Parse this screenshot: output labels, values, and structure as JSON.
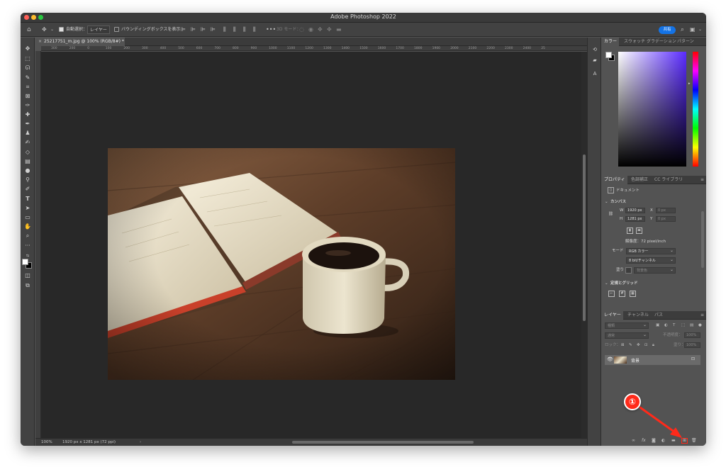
{
  "app": {
    "title": "Adobe Photoshop 2022"
  },
  "colors": {
    "accent": "#1473e6",
    "annotation": "#ff2a1a",
    "canvas": "#282828",
    "panel": "#535353"
  },
  "options_bar": {
    "auto_select_label": "自動選択：",
    "auto_select_value": "レイヤー",
    "show_bbox_label": "バウンディングボックスを表示",
    "mode_3d_label": "3D モード：",
    "share_label": "共有"
  },
  "document": {
    "tab_title": "25217751_m.jpg @ 100% (RGB/8#) *",
    "zoom": "100%",
    "status": "1920 px x 1281 px (72 ppi)"
  },
  "ruler": {
    "ticks": [
      "300",
      "200",
      "0",
      "100",
      "200",
      "300",
      "400",
      "500",
      "600",
      "700",
      "800",
      "900",
      "1000",
      "1100",
      "1200",
      "1300",
      "1400",
      "1500",
      "1600",
      "1700",
      "1800",
      "1900",
      "2000",
      "2100",
      "2200",
      "2300",
      "2400",
      "25"
    ]
  },
  "color_panel": {
    "tabs": [
      "カラー",
      "スウォッチ",
      "グラデーション",
      "パターン"
    ]
  },
  "properties_panel": {
    "tabs": [
      "プロパティ",
      "色調補正",
      "CC ライブラリ"
    ],
    "doc_label": "ドキュメント",
    "canvas_section": "カンバス",
    "w_label": "W",
    "w_value": "1920 px",
    "h_label": "H",
    "h_value": "1281 px",
    "x_label": "X",
    "x_value": "0 px",
    "y_label": "Y",
    "y_value": "0 px",
    "resolution": "解像度：72 pixel/inch",
    "mode_label": "モード",
    "mode_value": "RGB カラー",
    "depth_value": "8 bit/チャンネル",
    "fill_label": "塗り",
    "fill_value": "背景色",
    "guides_section": "定規とグリッド"
  },
  "layers_panel": {
    "tabs": [
      "レイヤー",
      "チャンネル",
      "パス"
    ],
    "filter_placeholder": "種類",
    "blend_mode": "通常",
    "opacity_label": "不透明度：",
    "opacity_value": "100%",
    "lock_label": "ロック：",
    "fill_label": "塗り：",
    "fill_value": "100%",
    "layer_name": "背景"
  },
  "annotation": {
    "number": "①"
  }
}
